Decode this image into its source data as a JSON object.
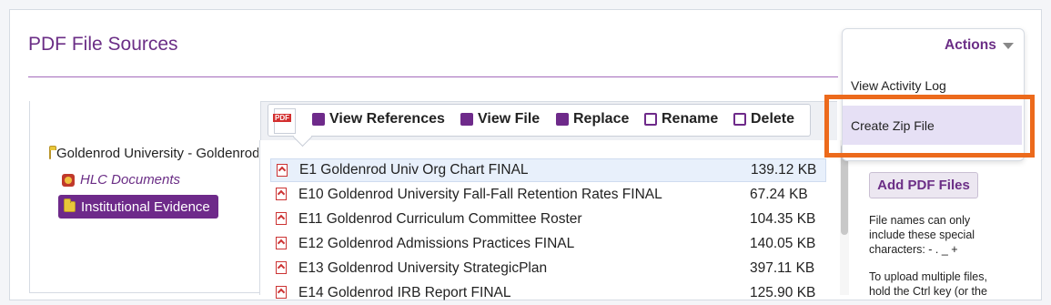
{
  "page": {
    "title": "PDF File Sources"
  },
  "tree": {
    "root": "Goldenrod University - Goldenrod",
    "items": [
      {
        "label": "HLC Documents"
      },
      {
        "label": "Institutional Evidence"
      }
    ]
  },
  "toolbar": {
    "view_references": "View References",
    "view_file": "View File",
    "replace": "Replace",
    "rename": "Rename",
    "delete": "Delete"
  },
  "files": [
    {
      "name": "E1 Goldenrod Univ Org Chart FINAL",
      "size": "139.12 KB"
    },
    {
      "name": "E10 Goldenrod University Fall-Fall Retention Rates FINAL",
      "size": "67.24 KB"
    },
    {
      "name": "E11 Goldenrod Curriculum Committee Roster",
      "size": "104.35 KB"
    },
    {
      "name": "E12 Goldenrod Admissions Practices FINAL",
      "size": "140.05 KB"
    },
    {
      "name": "E13 Goldenrod University StrategicPlan",
      "size": "397.11 KB"
    },
    {
      "name": "E14 Goldenrod IRB Report FINAL",
      "size": "125.90 KB"
    }
  ],
  "actions": {
    "label": "Actions",
    "items": [
      "View Activity Log",
      "Create Zip File"
    ]
  },
  "side": {
    "add_button": "Add PDF Files",
    "help1": [
      "File names can only",
      "include these special",
      "characters: - . _ +"
    ],
    "help2": [
      "To upload multiple files,",
      "hold the Ctrl key (or the"
    ]
  }
}
